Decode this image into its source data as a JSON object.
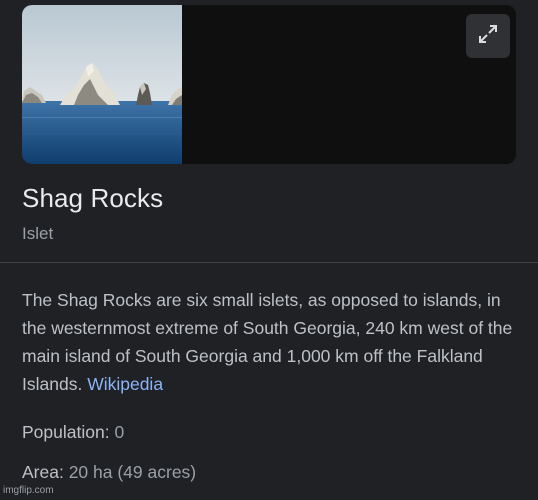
{
  "place": {
    "title": "Shag Rocks",
    "type": "Islet"
  },
  "description": {
    "text": "The Shag Rocks are six small islets, as opposed to islands, in the westernmost extreme of South Georgia, 240 km west of the main island of South Georgia and 1,000 km off the Falkland Islands.",
    "source_link": "Wikipedia"
  },
  "facts": {
    "population_label": "Population:",
    "population_value": "0",
    "area_label": "Area:",
    "area_value": "20 ha (49 acres)"
  },
  "media": {
    "expand_icon": "expand-arrows-icon"
  },
  "watermark": "imgflip.com",
  "colors": {
    "background": "#202124",
    "link": "#8ab4f8",
    "title": "#e8eaed",
    "secondary": "#9aa0a6",
    "body": "#bdc1c6"
  }
}
